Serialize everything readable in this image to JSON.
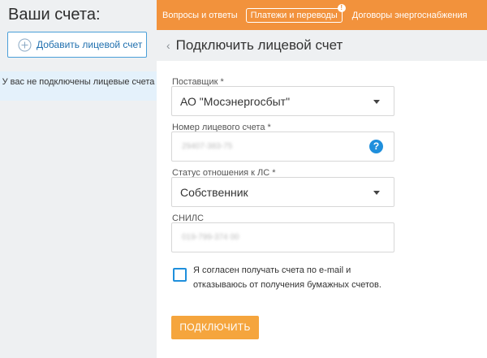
{
  "sidebar": {
    "title": "Ваши счета:",
    "add_button_label": "Добавить лицевой счет",
    "empty_message": "У вас не подключены лицевые счета"
  },
  "topnav": {
    "items": [
      "Вопросы и ответы",
      "Платежи и переводы",
      "Договоры энергоснабжения"
    ],
    "badge": "!"
  },
  "page": {
    "title": "Подключить лицевой счет"
  },
  "form": {
    "supplier": {
      "label": "Поставщик *",
      "value": "АО \"Мосэнергосбыт\""
    },
    "account_number": {
      "label": "Номер лицевого счета *",
      "value": "29407-383-75",
      "help": "?"
    },
    "status": {
      "label": "Статус отношения к ЛС *",
      "value": "Собственник"
    },
    "snils": {
      "label": "СНИЛС",
      "value": "019-799-374 00"
    },
    "consent_text": "Я согласен получать счета по e-mail и отказываюсь от получения бумажных счетов.",
    "consent_checked": false,
    "submit_label": "ПОДКЛЮЧИТЬ"
  },
  "colors": {
    "accent": "#f2923c",
    "link": "#1f6fae",
    "help": "#1f8fdc"
  }
}
